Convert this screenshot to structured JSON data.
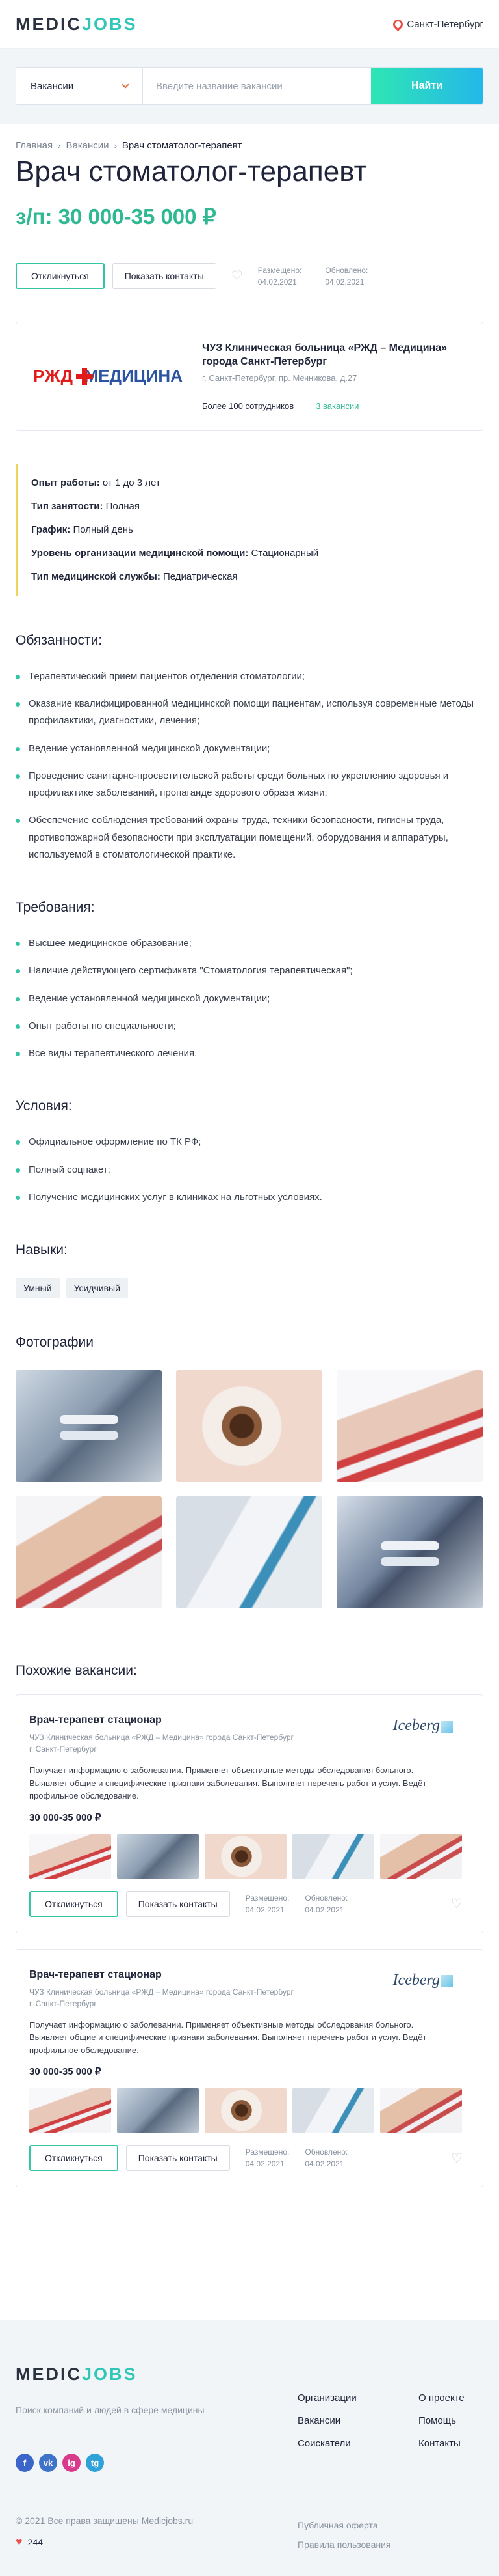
{
  "header": {
    "logo_a": "MEDIC",
    "logo_b": "JOBS",
    "city": "Санкт-Петербург"
  },
  "search": {
    "category": "Вакансии",
    "placeholder": "Введите название вакансии",
    "button": "Найти"
  },
  "breadcrumbs": [
    "Главная",
    "Вакансии",
    "Врач стоматолог-терапевт"
  ],
  "vacancy": {
    "title": "Врач стоматолог-терапевт",
    "salary": "з/п: 30 000-35 000 ₽",
    "respond": "Откликнуться",
    "contacts": "Показать контакты",
    "placed_label": "Размещено:",
    "placed_date": "04.02.2021",
    "updated_label": "Обновлено:",
    "updated_date": "04.02.2021"
  },
  "company": {
    "logo_a": "РЖД",
    "logo_b": "МЕДИЦИНА",
    "name": "ЧУЗ Клиническая больница «РЖД – Медицина» города Санкт-Петербург",
    "address": "г. Санкт-Петербург, пр. Мечникова, д.27",
    "employees": "Более 100 сотрудников",
    "vacancies_link": "3 вакансии"
  },
  "params": [
    {
      "label": "Опыт работы:",
      "value": " от 1 до 3 лет"
    },
    {
      "label": "Тип занятости:",
      "value": " Полная"
    },
    {
      "label": "График:",
      "value": " Полный день"
    },
    {
      "label": "Уровень организации медицинской помощи:",
      "value": " Стационарный"
    },
    {
      "label": "Тип медицинской службы:",
      "value": " Педиатрическая"
    }
  ],
  "duties": {
    "title": "Обязанности:",
    "items": [
      "Терапевтический приём пациентов отделения стоматологии;",
      "Оказание квалифицированной медицинской помощи пациентам, используя современные методы профилактики, диагностики, лечения;",
      "Ведение установленной медицинской документации;",
      "Проведение санитарно-просветительской работы среди больных по укреплению здоровья и профилактике заболеваний, пропаганде здорового образа жизни;",
      "Обеспечение соблюдения требований охраны труда, техники безопасности, гигиены труда, противопожарной безопасности при эксплуатации помещений, оборудования и аппаратуры, используемой в стоматологической практике."
    ]
  },
  "requirements": {
    "title": "Требования:",
    "items": [
      "Высшее медицинское образование;",
      "Наличие действующего сертификата \"Стоматология терапевтическая\";",
      "Ведение установленной медицинской документации;",
      "Опыт работы по специальности;",
      "Все виды терапевтического лечения."
    ]
  },
  "conditions": {
    "title": "Условия:",
    "items": [
      "Официальное оформление по ТК РФ;",
      "Полный соцпакет;",
      "Получение медицинских услуг в клиниках на льготных условиях."
    ]
  },
  "skills": {
    "title": "Навыки:",
    "items": [
      "Умный",
      "Усидчивый"
    ]
  },
  "photos": {
    "title": "Фотографии"
  },
  "similar": {
    "title": "Похожие вакансии:",
    "items": [
      {
        "title": "Врач-терапевт стационар",
        "company": "ЧУЗ Клиническая больница «РЖД – Медицина» города Санкт-Петербург",
        "city": "г. Санкт-Петербург",
        "logo": "Iceberg",
        "desc": "Получает информацию о заболевании. Применяет объективные методы обследования больного. Выявляет общие и специфические признаки заболевания. Выполняет перечень работ и услуг. Ведёт профильное обследование.",
        "salary": "30 000-35 000 ₽",
        "respond": "Откликнуться",
        "contacts": "Показать контакты",
        "placed_label": "Размещено:",
        "placed_date": "04.02.2021",
        "updated_label": "Обновлено:",
        "updated_date": "04.02.2021"
      },
      {
        "title": "Врач-терапевт стационар",
        "company": "ЧУЗ Клиническая больница «РЖД – Медицина» города Санкт-Петербург",
        "city": "г. Санкт-Петербург",
        "logo": "Iceberg",
        "desc": "Получает информацию о заболевании. Применяет объективные методы обследования больного. Выявляет общие и специфические признаки заболевания. Выполняет перечень работ и услуг. Ведёт профильное обследование.",
        "salary": "30 000-35 000 ₽",
        "respond": "Откликнуться",
        "contacts": "Показать контакты",
        "placed_label": "Размещено:",
        "placed_date": "04.02.2021",
        "updated_label": "Обновлено:",
        "updated_date": "04.02.2021"
      }
    ]
  },
  "footer": {
    "logo_a": "MEDIC",
    "logo_b": "JOBS",
    "tagline": "Поиск компаний и людей в сфере медицины",
    "social": [
      "f",
      "vk",
      "ig",
      "tg"
    ],
    "col1": [
      "Организации",
      "Вакансии",
      "Соискатели"
    ],
    "col2": [
      "О проекте",
      "Помощь",
      "Контакты"
    ],
    "copyright": "© 2021 Все права защищены Medicjobs.ru",
    "likes": "244",
    "links": [
      "Публичная оферта",
      "Правила пользования"
    ]
  },
  "colors": {
    "accent": "#33c6a4",
    "salary": "#2fb892",
    "params_border": "#f0d25c",
    "heart": "#e8524a"
  }
}
